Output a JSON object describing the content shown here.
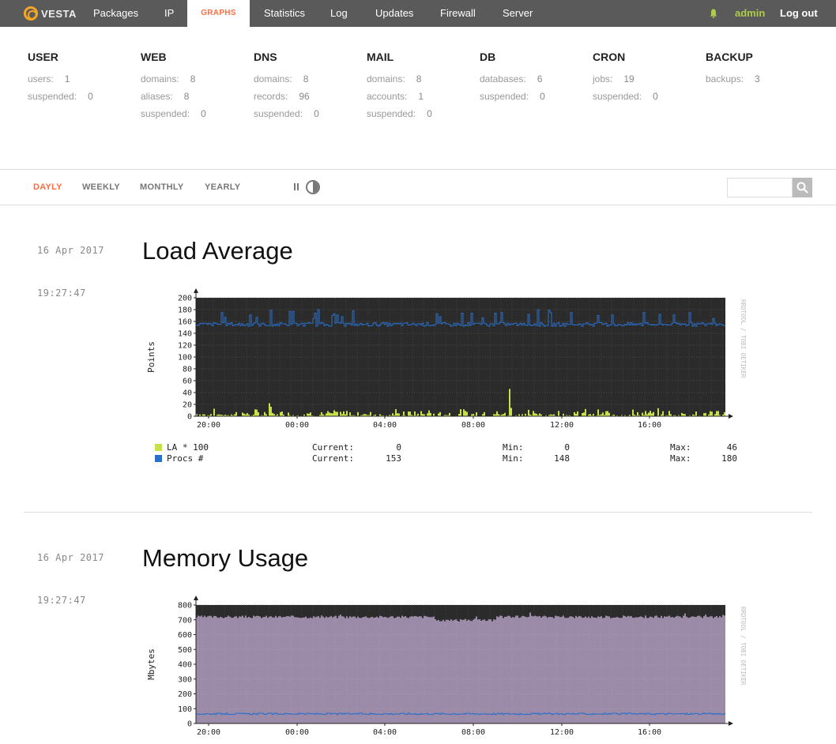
{
  "app": {
    "logo": "VESTA"
  },
  "nav": {
    "items": [
      "Packages",
      "IP",
      "GRAPHS",
      "Statistics",
      "Log",
      "Updates",
      "Firewall",
      "Server"
    ],
    "user": "admin",
    "logout": "Log out"
  },
  "stats": [
    {
      "title": "USER",
      "rows": [
        [
          "users:",
          "1"
        ],
        [
          "suspended:",
          "0"
        ]
      ]
    },
    {
      "title": "WEB",
      "rows": [
        [
          "domains:",
          "8"
        ],
        [
          "aliases:",
          "8"
        ],
        [
          "suspended:",
          "0"
        ]
      ]
    },
    {
      "title": "DNS",
      "rows": [
        [
          "domains:",
          "8"
        ],
        [
          "records:",
          "96"
        ],
        [
          "suspended:",
          "0"
        ]
      ]
    },
    {
      "title": "MAIL",
      "rows": [
        [
          "domains:",
          "8"
        ],
        [
          "accounts:",
          "1"
        ],
        [
          "suspended:",
          "0"
        ]
      ]
    },
    {
      "title": "DB",
      "rows": [
        [
          "databases:",
          "6"
        ],
        [
          "suspended:",
          "0"
        ]
      ]
    },
    {
      "title": "CRON",
      "rows": [
        [
          "jobs:",
          "19"
        ],
        [
          "suspended:",
          "0"
        ]
      ]
    },
    {
      "title": "BACKUP",
      "rows": [
        [
          "backups:",
          "3"
        ]
      ]
    }
  ],
  "toolbar": {
    "periods": [
      "DAYLY",
      "WEEKLY",
      "MONTHLY",
      "YEARLY"
    ],
    "active_period": "DAYLY",
    "search_placeholder": ""
  },
  "graphs": [
    {
      "date": "16 Apr 2017",
      "time": "19:27:47",
      "title": "Load Average",
      "legend": [
        {
          "name": "LA * 100",
          "color": "#c8e04a",
          "current": "0",
          "min": "0",
          "max": "46"
        },
        {
          "name": "Procs #",
          "color": "#2a6fc9",
          "current": "153",
          "min": "148",
          "max": "180"
        }
      ]
    },
    {
      "date": "16 Apr 2017",
      "time": "19:27:47",
      "title": "Memory Usage"
    }
  ],
  "legend_labels": {
    "current": "Current:",
    "min": "Min:",
    "max": "Max:"
  },
  "chart_data": [
    {
      "type": "area",
      "title": "",
      "ylabel": "Points",
      "watermark": "RRDTOOL / TOBI OETIKER",
      "ylim": [
        0,
        200
      ],
      "yticks": [
        0,
        20,
        40,
        60,
        80,
        100,
        120,
        140,
        160,
        180,
        200
      ],
      "xticks": [
        "20:00",
        "00:00",
        "04:00",
        "08:00",
        "12:00",
        "16:00"
      ],
      "series": [
        {
          "name": "LA * 100",
          "color": "#c8e04a",
          "current": 0,
          "min": 0,
          "max": 46,
          "typical": 5
        },
        {
          "name": "Procs #",
          "color": "#2a6fc9",
          "current": 153,
          "min": 148,
          "max": 180,
          "typical": 155
        }
      ]
    },
    {
      "type": "area",
      "title": "",
      "ylabel": "Mbytes",
      "watermark": "RRDTOOL / TOBI OETIKER",
      "ylim": [
        0,
        800
      ],
      "yticks": [
        0,
        100,
        200,
        300,
        400,
        500,
        600,
        700,
        800
      ],
      "xticks": [
        "20:00",
        "00:00",
        "04:00",
        "08:00",
        "12:00",
        "16:00"
      ],
      "series": [
        {
          "color": "#9b8aa8",
          "typical": 720
        },
        {
          "color": "#2a6fc9",
          "typical": 65
        }
      ]
    }
  ]
}
